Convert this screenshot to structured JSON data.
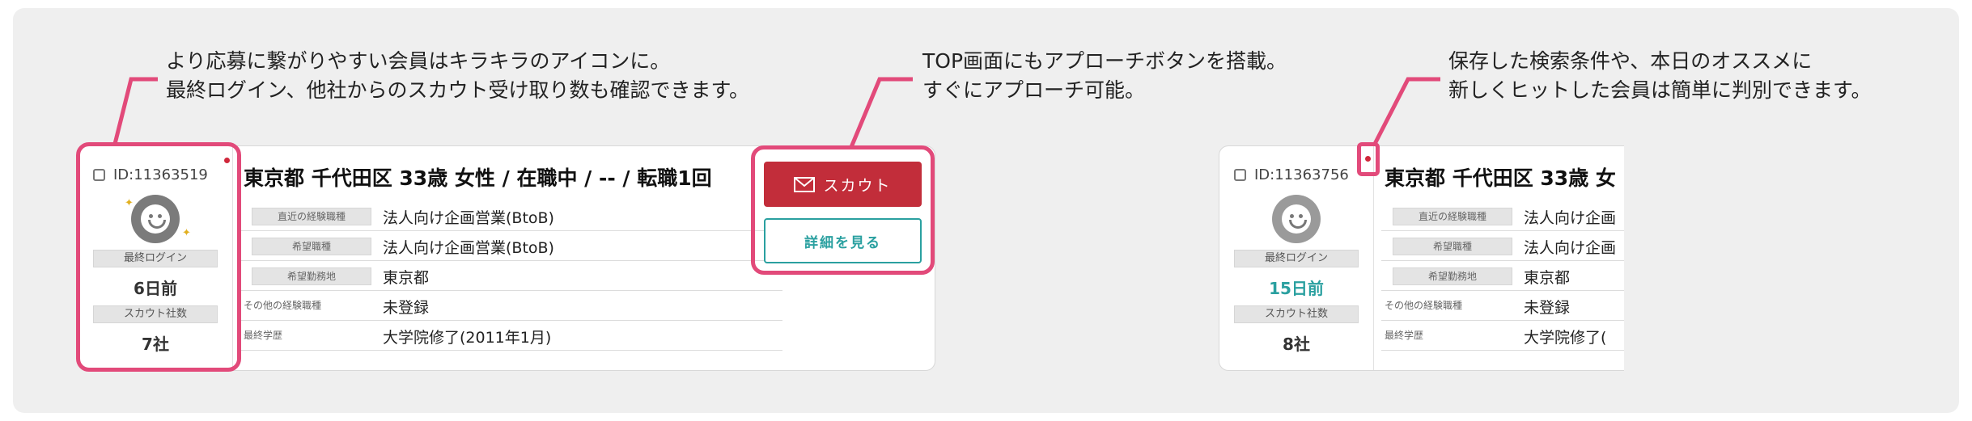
{
  "colors": {
    "accent": "#e24a7a",
    "scout": "#c22d3a",
    "teal": "#2aa0a0"
  },
  "annotations": {
    "a1_line1": "より応募に繋がりやすい会員はキラキラのアイコンに。",
    "a1_line2": "最終ログイン、他社からのスカウト受け取り数も確認できます。",
    "a2_line1": "TOP画面にもアプローチボタンを搭載。",
    "a2_line2": "すぐにアプローチ可能。",
    "a3_line1": "保存した検索条件や、本日のオススメに",
    "a3_line2": "新しくヒットした会員は簡単に判別できます。"
  },
  "card1": {
    "id": "ID:11363519",
    "last_login_label": "最終ログイン",
    "last_login_value": "6日前",
    "scout_count_label": "スカウト社数",
    "scout_count_value": "7社",
    "title": "東京都 千代田区 33歳 女性 / 在職中 / -- / 転職1回",
    "rows": [
      {
        "label": "直近の経験職種",
        "value": "法人向け企画営業(BtoB)"
      },
      {
        "label": "希望職種",
        "value": "法人向け企画営業(BtoB)"
      },
      {
        "label": "希望勤務地",
        "value": "東京都"
      },
      {
        "label": "その他の経験職種",
        "value": "未登録"
      },
      {
        "label": "最終学歴",
        "value": "大学院修了(2011年1月)"
      }
    ],
    "scout_button": "スカウト",
    "detail_button": "詳細を見る",
    "mail_icon": "mail-icon",
    "sparkle_icon": "sparkle-icon"
  },
  "card2": {
    "id": "ID:11363756",
    "last_login_label": "最終ログイン",
    "last_login_value": "15日前",
    "scout_count_label": "スカウト社数",
    "scout_count_value": "8社",
    "title": "東京都 千代田区 33歳 女",
    "rows": [
      {
        "label": "直近の経験職種",
        "value": "法人向け企画"
      },
      {
        "label": "希望職種",
        "value": "法人向け企画"
      },
      {
        "label": "希望勤務地",
        "value": "東京都"
      },
      {
        "label": "その他の経験職種",
        "value": "未登録"
      },
      {
        "label": "最終学歴",
        "value": "大学院修了("
      }
    ]
  }
}
